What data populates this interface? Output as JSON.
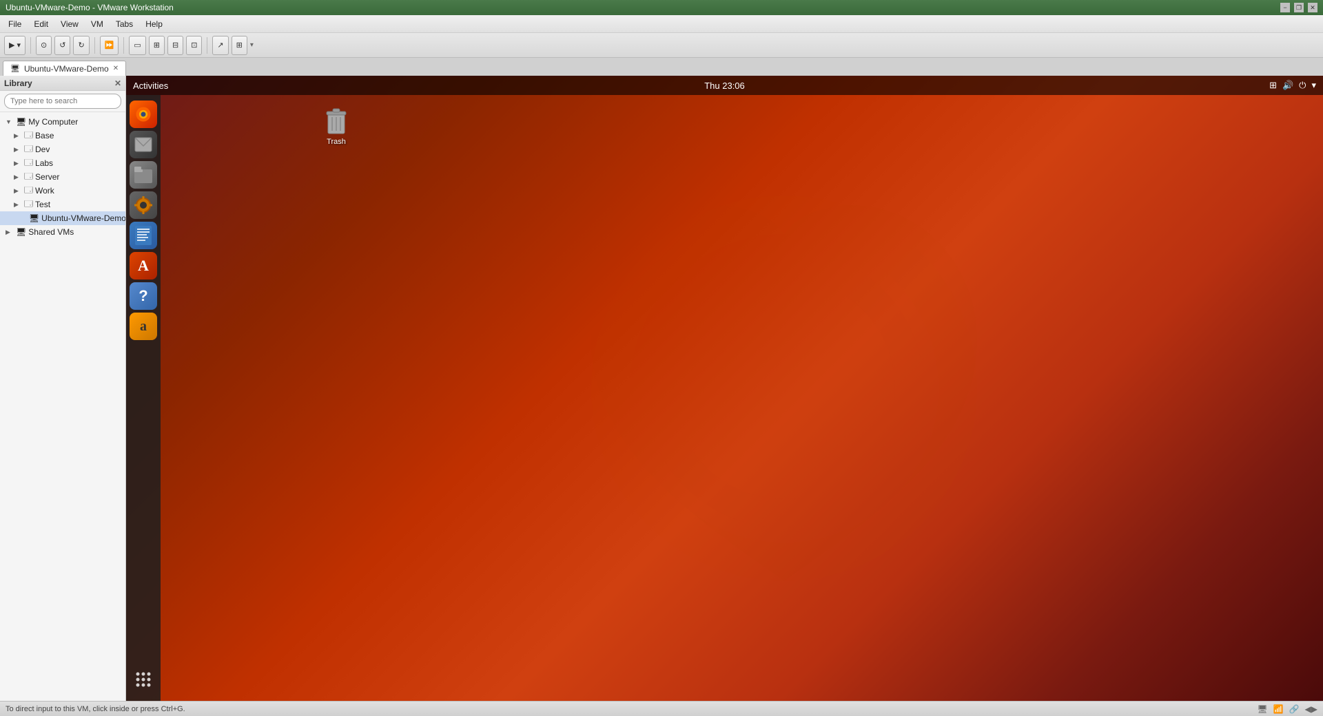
{
  "titlebar": {
    "title": "Ubuntu-VMware-Demo - VMware Workstation",
    "minimize_label": "−",
    "restore_label": "❐",
    "close_label": "✕"
  },
  "menubar": {
    "items": [
      "File",
      "Edit",
      "View",
      "VM",
      "Tabs",
      "Help"
    ]
  },
  "toolbar": {
    "power_label": "▶",
    "power_dropdown": "▾",
    "buttons": [
      "⊙",
      "↺",
      "↻",
      "⏩",
      "▭",
      "⊞",
      "⊟",
      "⊡",
      "⊠",
      "↗",
      "⊞"
    ]
  },
  "tabbar": {
    "active_tab": "Ubuntu-VMware-Demo",
    "close_label": "✕"
  },
  "library": {
    "title": "Library",
    "close_label": "✕",
    "search_placeholder": "Type here to search",
    "tree": {
      "my_computer": {
        "label": "My Computer",
        "children": [
          {
            "label": "Base"
          },
          {
            "label": "Dev"
          },
          {
            "label": "Labs"
          },
          {
            "label": "Server"
          },
          {
            "label": "Work"
          },
          {
            "label": "Test"
          },
          {
            "label": "Ubuntu-VMware-Demo"
          }
        ]
      },
      "shared_vms": {
        "label": "Shared VMs"
      }
    }
  },
  "ubuntu": {
    "topbar": {
      "activities": "Activities",
      "clock": "Thu 23:06"
    },
    "dock": {
      "icons": [
        {
          "name": "firefox",
          "label": "Firefox",
          "symbol": "🦊"
        },
        {
          "name": "email",
          "label": "Email",
          "symbol": "✉"
        },
        {
          "name": "files",
          "label": "Files",
          "symbol": "📁"
        },
        {
          "name": "settings",
          "label": "Settings",
          "symbol": "⚙"
        },
        {
          "name": "writer",
          "label": "LibreOffice Writer",
          "symbol": "📝"
        },
        {
          "name": "appstore",
          "label": "App Store",
          "symbol": "A"
        },
        {
          "name": "help",
          "label": "Help",
          "symbol": "?"
        },
        {
          "name": "amazon",
          "label": "Amazon",
          "symbol": "a"
        }
      ],
      "apps_grid": "⠿"
    },
    "desktop": {
      "trash_label": "Trash"
    }
  },
  "statusbar": {
    "hint": "To direct input to this VM, click inside or press Ctrl+G.",
    "icons": [
      "🖥",
      "📶",
      "🔗",
      "◀▶"
    ]
  }
}
